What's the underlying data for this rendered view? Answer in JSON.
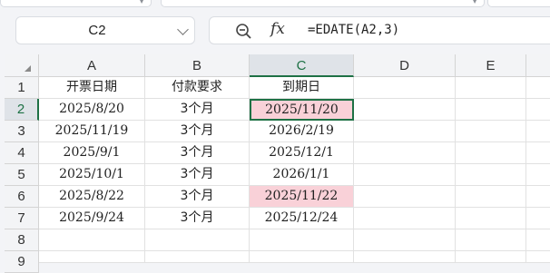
{
  "name_box": {
    "value": "C2"
  },
  "formula_bar": {
    "fx_label": "fx",
    "formula": "=EDATE(A2,3)"
  },
  "colors": {
    "accent": "#1e7145",
    "highlight": "#f9d1d8"
  },
  "columns": [
    "A",
    "B",
    "C",
    "D",
    "E"
  ],
  "rows": [
    "1",
    "2",
    "3",
    "4",
    "5",
    "6",
    "7",
    "8",
    "9"
  ],
  "cells": {
    "r1": {
      "a": "开票日期",
      "b": "付款要求",
      "c": "到期日"
    },
    "r2": {
      "a": "2025/8/20",
      "b": "3个月",
      "c": "2025/11/20"
    },
    "r3": {
      "a": "2025/11/19",
      "b": "3个月",
      "c": "2026/2/19"
    },
    "r4": {
      "a": "2025/9/1",
      "b": "3个月",
      "c": "2025/12/1"
    },
    "r5": {
      "a": "2025/10/1",
      "b": "3个月",
      "c": "2026/1/1"
    },
    "r6": {
      "a": "2025/8/22",
      "b": "3个月",
      "c": "2025/11/22"
    },
    "r7": {
      "a": "2025/9/24",
      "b": "3个月",
      "c": "2025/12/24"
    }
  }
}
